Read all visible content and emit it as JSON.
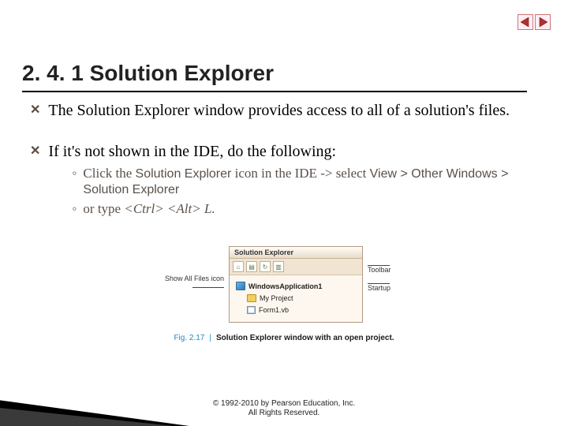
{
  "nav": {
    "prev_name": "prev-arrow-icon",
    "next_name": "next-arrow-icon"
  },
  "heading": "2. 4. 1 Solution Explorer",
  "bullets": [
    {
      "text": "The Solution Explorer window  provides access to all of a solution's files."
    },
    {
      "text": "If it's not shown in the IDE, do the following:"
    }
  ],
  "sub_items": {
    "a_prefix": " Click the ",
    "a_sans1": "Solution Explorer",
    "a_mid": " icon in the IDE -> select ",
    "a_sans2": "View > Other Windows > Solution Explorer",
    "b_prefix": "or type ",
    "b_ctrl": "<Ctrl>",
    "b_alt": " <Alt>",
    "b_tail": " L."
  },
  "figure": {
    "callout_left": "Show All Files icon",
    "callout_right_1": "Toolbar",
    "callout_right_2": "Startup",
    "panel_title": "Solution Explorer",
    "tree": {
      "root": "WindowsApplication1",
      "child1": "My Project",
      "child2": "Form1.vb"
    },
    "caption_label": "Fig. 2.17",
    "caption_text": "Solution Explorer window with an open project."
  },
  "copyright": {
    "line1": "© 1992-2010 by Pearson Education, Inc.",
    "line2": "All Rights Reserved."
  }
}
